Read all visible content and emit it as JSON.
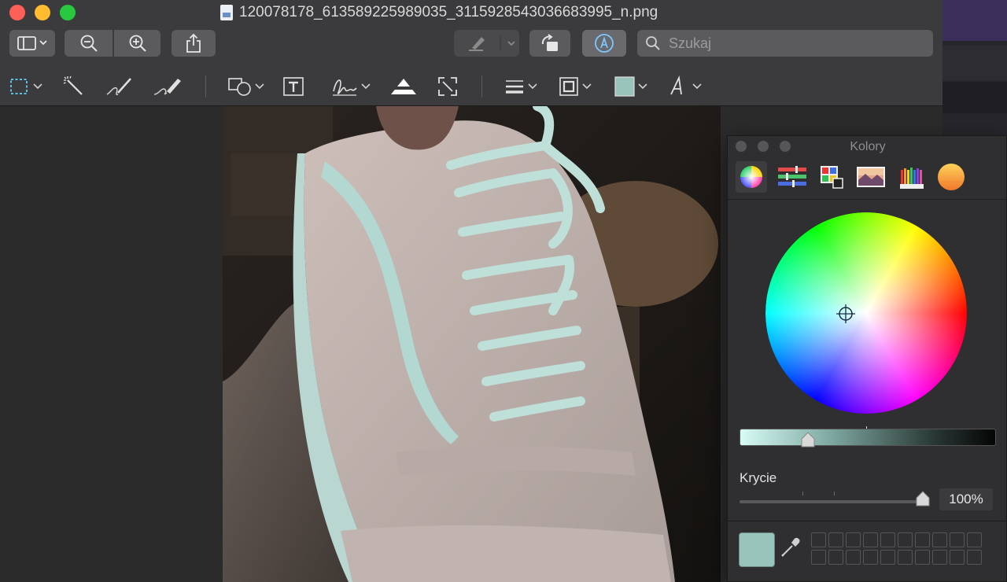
{
  "window": {
    "title": "120078178_613589225989035_3115928543036683995_n.png",
    "traffic_lights": [
      "close",
      "minimize",
      "zoom"
    ]
  },
  "toolbar": {
    "buttons": [
      {
        "name": "sidebar-toggle",
        "icon": "sidebar-icon"
      },
      {
        "name": "zoom-out",
        "icon": "zoom-out-icon"
      },
      {
        "name": "zoom-in",
        "icon": "zoom-in-icon"
      },
      {
        "name": "share",
        "icon": "share-icon"
      },
      {
        "name": "highlight",
        "icon": "pen-icon"
      },
      {
        "name": "rotate",
        "icon": "rotate-left-icon"
      },
      {
        "name": "markup",
        "icon": "markup-icon"
      }
    ],
    "search_placeholder": "Szukaj"
  },
  "markup_toolbar": {
    "tools": [
      {
        "name": "selection-tool",
        "icon": "rect-selection-icon",
        "menu": true
      },
      {
        "name": "instant-alpha",
        "icon": "magic-wand-icon",
        "menu": false
      },
      {
        "name": "sketch",
        "icon": "sketch-icon",
        "menu": false
      },
      {
        "name": "draw",
        "icon": "draw-icon",
        "menu": false
      },
      {
        "name": "shapes",
        "icon": "shapes-icon",
        "menu": true
      },
      {
        "name": "text",
        "icon": "text-box-icon",
        "menu": false
      },
      {
        "name": "sign",
        "icon": "signature-icon",
        "menu": true
      },
      {
        "name": "adjust-color",
        "icon": "adjust-color-icon",
        "menu": false
      },
      {
        "name": "adjust-size",
        "icon": "resize-icon",
        "menu": false
      },
      {
        "name": "shape-style",
        "icon": "line-style-icon",
        "menu": true
      },
      {
        "name": "border-color",
        "icon": "border-color-icon",
        "menu": true
      },
      {
        "name": "fill-color",
        "icon": "fill-color-icon",
        "menu": true
      },
      {
        "name": "text-style",
        "icon": "text-style-icon",
        "menu": true
      }
    ],
    "fill_color": "#98c4bc"
  },
  "colors_panel": {
    "title": "Kolory",
    "modes": [
      {
        "name": "color-wheel",
        "icon": "color-wheel-icon",
        "selected": true
      },
      {
        "name": "color-sliders",
        "icon": "sliders-icon",
        "selected": false
      },
      {
        "name": "color-palettes",
        "icon": "palette-icon",
        "selected": false
      },
      {
        "name": "image-palettes",
        "icon": "image-palette-icon",
        "selected": false
      },
      {
        "name": "pencils",
        "icon": "pencils-icon",
        "selected": false
      },
      {
        "name": "extra",
        "icon": "orange-circle-icon",
        "selected": false
      }
    ],
    "brightness_level": 0.27,
    "opacity_label": "Krycie",
    "opacity_value": "100%",
    "current_color": "#98c4bc"
  }
}
